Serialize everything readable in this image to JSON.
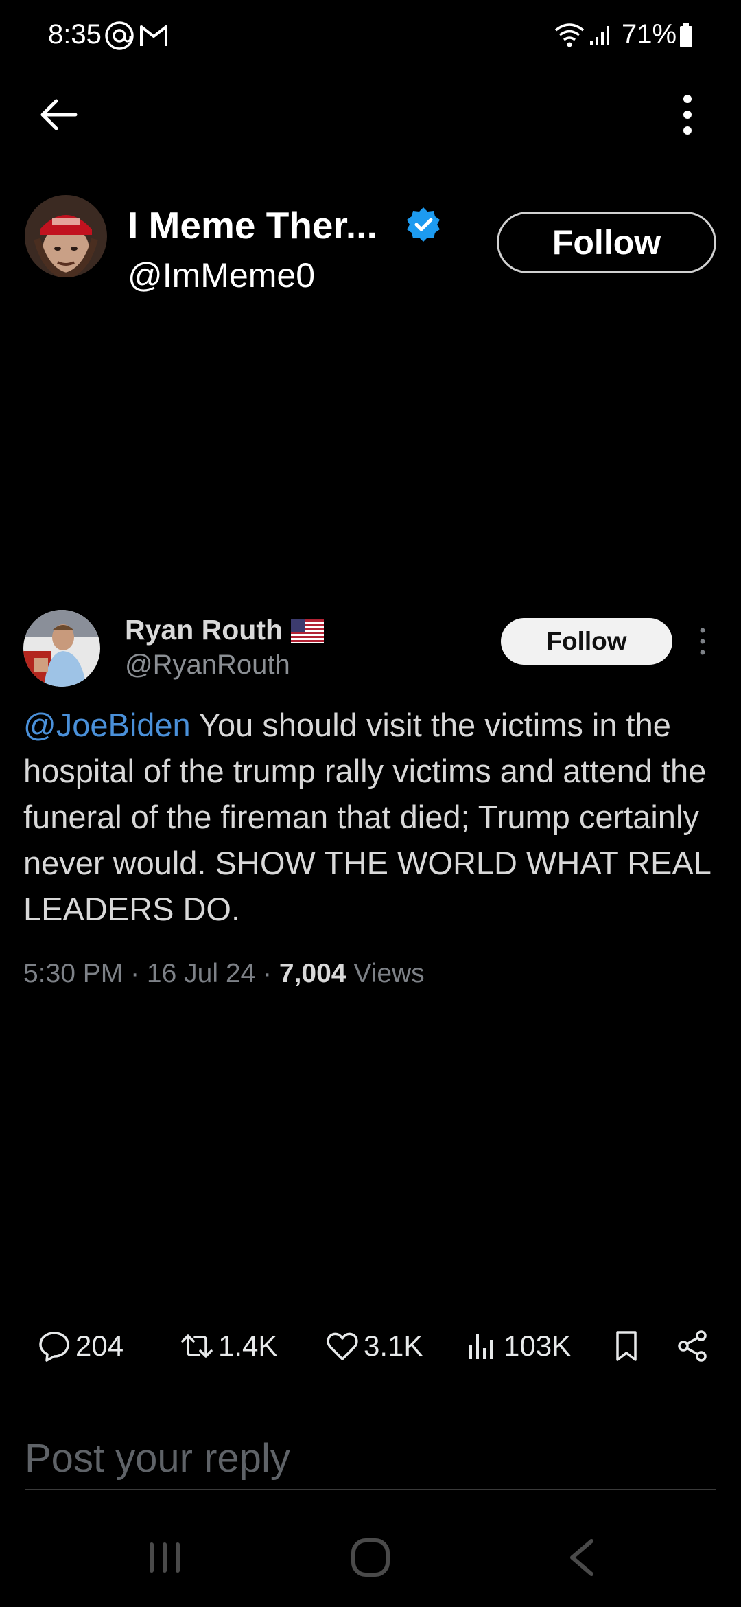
{
  "status_bar": {
    "time": "8:35",
    "battery_pct": "71%",
    "icons": [
      "threads-icon",
      "gmail-icon",
      "wifi-icon",
      "signal-icon",
      "battery-icon"
    ]
  },
  "top_bar": {
    "back_icon": "back-arrow-icon",
    "menu_icon": "more-vertical-icon"
  },
  "profile": {
    "name": "I Meme Ther...",
    "handle": "@ImMeme0",
    "verified": true,
    "follow_label": "Follow"
  },
  "tweet": {
    "author_name": "Ryan Routh",
    "author_handle": "@RyanRouth",
    "flag": "us-flag-icon",
    "follow_label": "Follow",
    "mention": "@JoeBiden",
    "text": " You should visit the victims in the hospital of the trump rally victims and attend the funeral of the fireman that died; Trump certainly never would. SHOW THE WORLD WHAT REAL LEADERS DO.",
    "time": "5:30 PM",
    "date": "16 Jul 24",
    "views_count": "7,004",
    "views_label": "Views"
  },
  "actions": {
    "replies": "204",
    "reposts": "1.4K",
    "likes": "3.1K",
    "views": "103K"
  },
  "reply": {
    "placeholder": "Post your reply"
  },
  "colors": {
    "background": "#000000",
    "link": "#4a90d9",
    "verified": "#1d9bf0"
  }
}
